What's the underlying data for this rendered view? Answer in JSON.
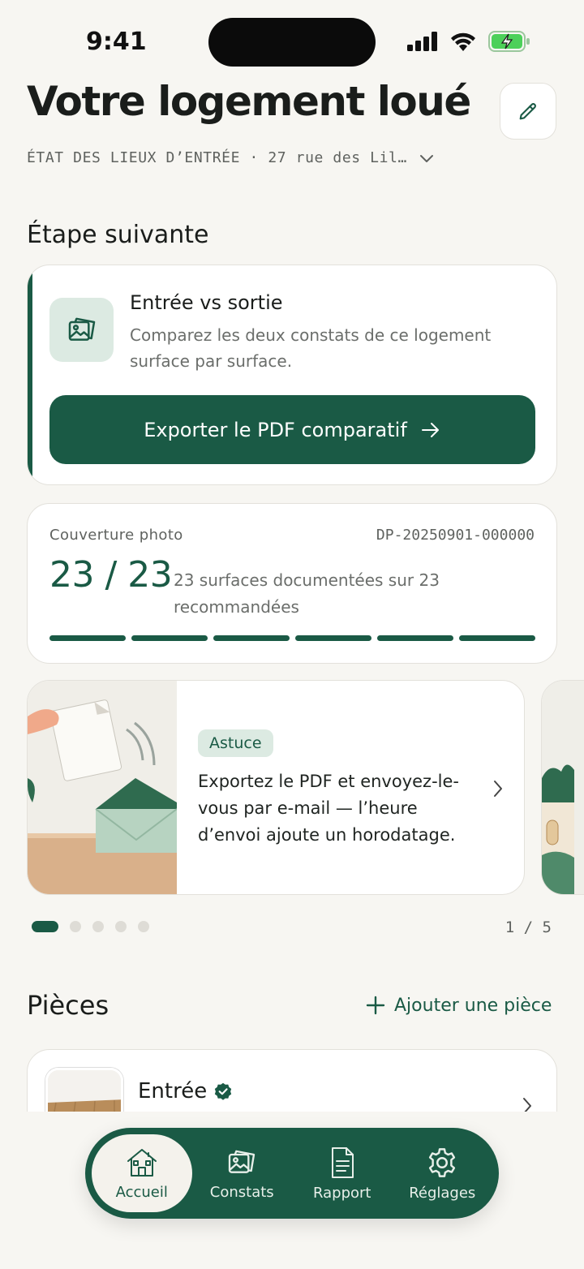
{
  "status_bar": {
    "time": "9:41"
  },
  "header": {
    "title": "Votre logement loué",
    "subtitle": "ÉTAT DES LIEUX D’ENTRÉE · 27 rue des Lil…"
  },
  "next_step": {
    "section_title": "Étape suivante",
    "title": "Entrée vs sortie",
    "description": "Comparez les deux constats de ce logement surface par surface.",
    "button_label": "Exporter le PDF comparatif"
  },
  "coverage": {
    "label": "Couverture photo",
    "id": "DP-20250901-000000",
    "count": "23 / 23",
    "description": "23 surfaces documentées sur 23 recommandées",
    "progress_segments": 6,
    "progress_filled": 6
  },
  "tip": {
    "badge": "Astuce",
    "text": "Exportez le PDF et envoyez-le-vous par e-mail — l’heure d’envoi ajoute un horodatage.",
    "pager": "1 / 5",
    "dots_total": 5,
    "dots_active": 1
  },
  "rooms": {
    "title": "Pièces",
    "add_label": "Ajouter une pièce",
    "items": [
      {
        "name": "Entrée",
        "verified": true
      }
    ]
  },
  "tab_bar": {
    "tabs": [
      {
        "label": "Accueil",
        "icon": "home-icon",
        "active": true
      },
      {
        "label": "Constats",
        "icon": "photos-icon",
        "active": false
      },
      {
        "label": "Rapport",
        "icon": "document-icon",
        "active": false
      },
      {
        "label": "Réglages",
        "icon": "gear-icon",
        "active": false
      }
    ]
  },
  "colors": {
    "accent": "#1a5a45",
    "background": "#f7f6f2",
    "accent_soft": "#dceae2"
  }
}
